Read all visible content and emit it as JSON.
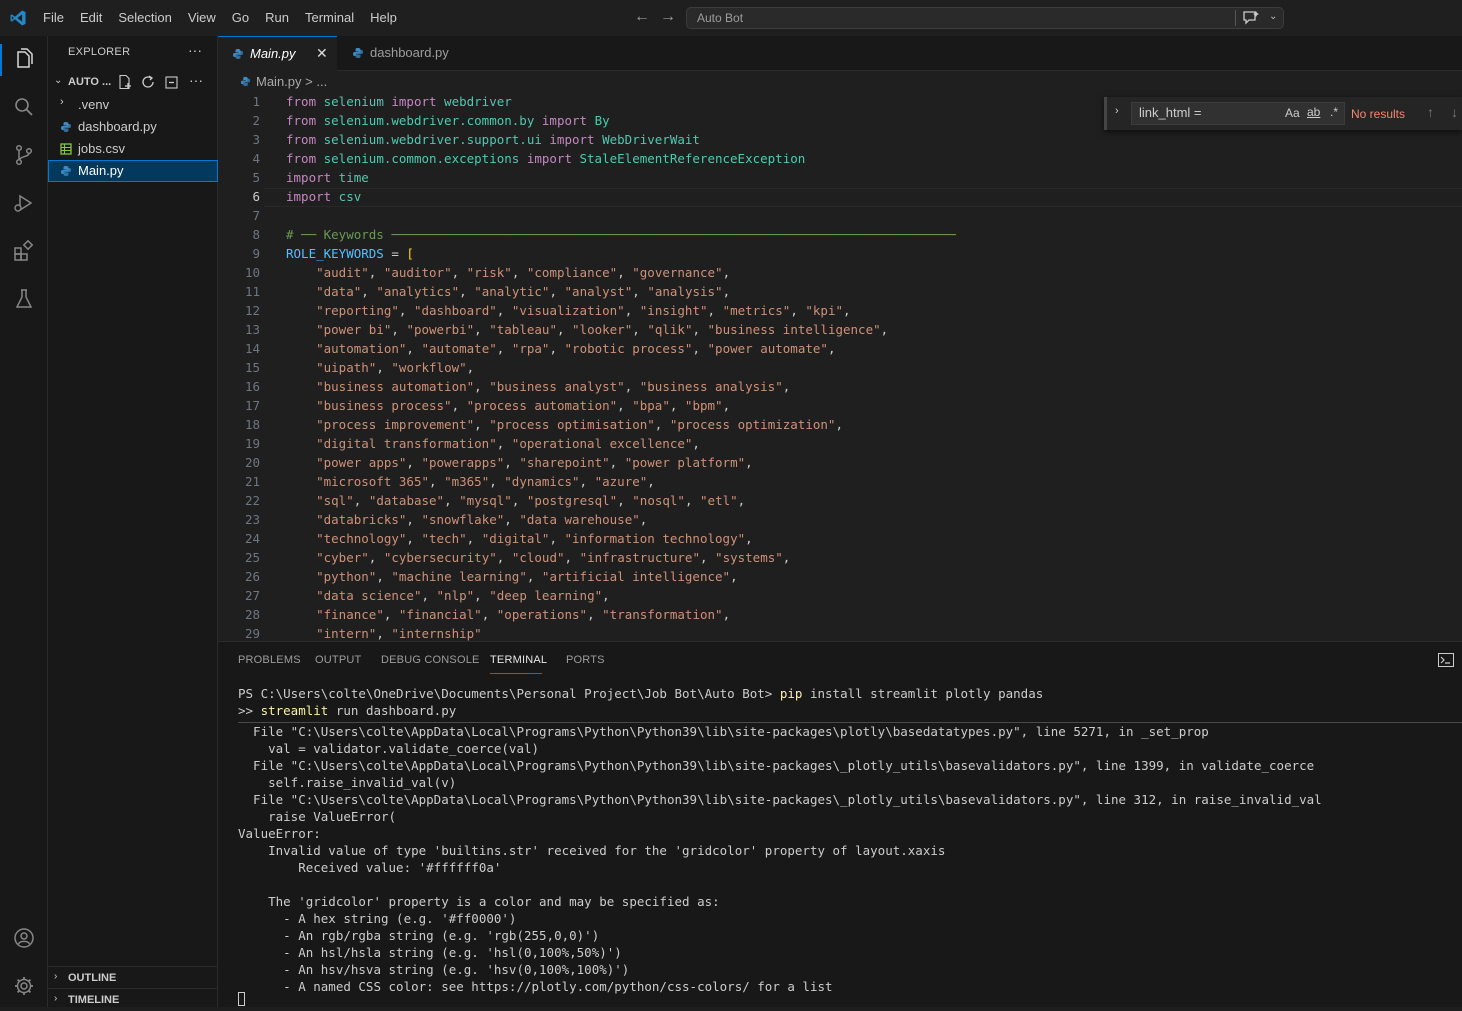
{
  "menu": [
    "File",
    "Edit",
    "Selection",
    "View",
    "Go",
    "Run",
    "Terminal",
    "Help"
  ],
  "command_center": {
    "text": "Auto Bot"
  },
  "explorer": {
    "title": "EXPLORER",
    "folder": "AUTO ...",
    "files": [
      {
        "name": ".venv",
        "type": "folder"
      },
      {
        "name": "dashboard.py",
        "type": "python"
      },
      {
        "name": "jobs.csv",
        "type": "csv"
      },
      {
        "name": "Main.py",
        "type": "python",
        "selected": true
      }
    ],
    "outline": "OUTLINE",
    "timeline": "TIMELINE"
  },
  "tabs": [
    {
      "label": "Main.py",
      "active": true
    },
    {
      "label": "dashboard.py",
      "active": false
    }
  ],
  "breadcrumb": {
    "file": "Main.py",
    "rest": "> ..."
  },
  "editor": {
    "current_line": 6,
    "line_numbers": [
      "1",
      "2",
      "3",
      "4",
      "5",
      "6",
      "7",
      "8",
      "9",
      "10",
      "11",
      "12",
      "13",
      "14",
      "15",
      "16",
      "17",
      "18",
      "19",
      "20",
      "21",
      "22",
      "23",
      "24",
      "25",
      "26",
      "27",
      "28",
      "29"
    ]
  },
  "find": {
    "query": "link_html =",
    "match_case": "Aa",
    "whole_word": "ab",
    "regex": ".*",
    "result": "No results"
  },
  "panel": {
    "tabs": [
      "PROBLEMS",
      "OUTPUT",
      "DEBUG CONSOLE",
      "TERMINAL",
      "PORTS"
    ],
    "active_tab": "TERMINAL",
    "terminal_prompt": "PS C:\\Users\\colte\\OneDrive\\Documents\\Personal Project\\Job Bot\\Auto Bot> ",
    "terminal_cmd1_exe": "pip",
    "terminal_cmd1_args": " install streamlit plotly pandas",
    "terminal_cont": ">> ",
    "terminal_cmd2_exe": "streamlit",
    "terminal_cmd2_args": " run dashboard.py",
    "terminal_output": [
      "  File \"C:\\Users\\colte\\AppData\\Local\\Programs\\Python\\Python39\\lib\\site-packages\\plotly\\basedatatypes.py\", line 5271, in _set_prop",
      "    val = validator.validate_coerce(val)",
      "  File \"C:\\Users\\colte\\AppData\\Local\\Programs\\Python\\Python39\\lib\\site-packages\\_plotly_utils\\basevalidators.py\", line 1399, in validate_coerce",
      "    self.raise_invalid_val(v)",
      "  File \"C:\\Users\\colte\\AppData\\Local\\Programs\\Python\\Python39\\lib\\site-packages\\_plotly_utils\\basevalidators.py\", line 312, in raise_invalid_val",
      "    raise ValueError(",
      "ValueError:",
      "    Invalid value of type 'builtins.str' received for the 'gridcolor' property of layout.xaxis",
      "        Received value: '#ffffff0a'",
      "",
      "    The 'gridcolor' property is a color and may be specified as:",
      "      - A hex string (e.g. '#ff0000')",
      "      - An rgb/rgba string (e.g. 'rgb(255,0,0)')",
      "      - An hsl/hsla string (e.g. 'hsl(0,100%,50%)')",
      "      - An hsv/hsva string (e.g. 'hsv(0,100%,100%)')",
      "      - A named CSS color: see https://plotly.com/python/css-colors/ for a list"
    ]
  },
  "code": {
    "l1": {
      "kw1": "from",
      "mod": " selenium ",
      "kw2": "import",
      "name": " webdriver"
    },
    "l2": {
      "kw1": "from",
      "mod": " selenium.webdriver.common.by ",
      "kw2": "import",
      "name": " By"
    },
    "l3": {
      "kw1": "from",
      "mod": " selenium.webdriver.support.ui ",
      "kw2": "import",
      "name": " WebDriverWait"
    },
    "l4": {
      "kw1": "from",
      "mod": " selenium.common.exceptions ",
      "kw2": "import",
      "name": " StaleElementReferenceException"
    },
    "l5": {
      "kw": "import",
      "mod": " time"
    },
    "l6": {
      "kw": "import",
      "mod": " csv"
    },
    "l8": {
      "comment": "# ── Keywords ───────────────────────────────────────────────────────────────────────────"
    },
    "l9": {
      "var": "ROLE_KEYWORDS",
      "op": " = ",
      "bracket": "["
    },
    "keyword_lines": [
      [
        "audit",
        "auditor",
        "risk",
        "compliance",
        "governance"
      ],
      [
        "data",
        "analytics",
        "analytic",
        "analyst",
        "analysis"
      ],
      [
        "reporting",
        "dashboard",
        "visualization",
        "insight",
        "metrics",
        "kpi"
      ],
      [
        "power bi",
        "powerbi",
        "tableau",
        "looker",
        "qlik",
        "business intelligence"
      ],
      [
        "automation",
        "automate",
        "rpa",
        "robotic process",
        "power automate"
      ],
      [
        "uipath",
        "workflow"
      ],
      [
        "business automation",
        "business analyst",
        "business analysis"
      ],
      [
        "business process",
        "process automation",
        "bpa",
        "bpm"
      ],
      [
        "process improvement",
        "process optimisation",
        "process optimization"
      ],
      [
        "digital transformation",
        "operational excellence"
      ],
      [
        "power apps",
        "powerapps",
        "sharepoint",
        "power platform"
      ],
      [
        "microsoft 365",
        "m365",
        "dynamics",
        "azure"
      ],
      [
        "sql",
        "database",
        "mysql",
        "postgresql",
        "nosql",
        "etl"
      ],
      [
        "databricks",
        "snowflake",
        "data warehouse"
      ],
      [
        "technology",
        "tech",
        "digital",
        "information technology"
      ],
      [
        "cyber",
        "cybersecurity",
        "cloud",
        "infrastructure",
        "systems"
      ],
      [
        "python",
        "machine learning",
        "artificial intelligence"
      ],
      [
        "data science",
        "nlp",
        "deep learning"
      ],
      [
        "finance",
        "financial",
        "operations",
        "transformation"
      ],
      [
        "intern",
        "internship"
      ]
    ],
    "keyword_trailing_comma": [
      true,
      true,
      true,
      true,
      true,
      true,
      true,
      true,
      true,
      true,
      true,
      true,
      true,
      true,
      true,
      true,
      true,
      true,
      true,
      false
    ]
  },
  "colors": {
    "accent": "#0078d4",
    "error_text": "#f48771",
    "keyword": "#c586c0",
    "string": "#ce9178",
    "module": "#4ec9b0"
  }
}
